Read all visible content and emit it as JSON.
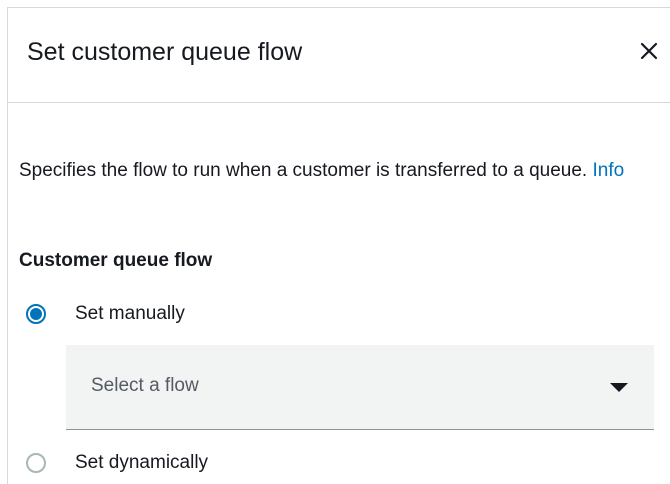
{
  "dialog": {
    "title": "Set customer queue flow",
    "close_icon": "close-icon"
  },
  "description": {
    "text": "Specifies the flow to run when a customer is transferred to a queue.",
    "info_link": "Info",
    "link_color": "#0073bb"
  },
  "section": {
    "label": "Customer queue flow"
  },
  "options": [
    {
      "label": "Set manually",
      "selected": true
    },
    {
      "label": "Set dynamically",
      "selected": false
    }
  ],
  "select": {
    "placeholder": "Select a flow",
    "icon": "caret-down-icon"
  },
  "colors": {
    "accent": "#0073bb",
    "text": "#16191f",
    "select_background": "#f2f3f3"
  }
}
